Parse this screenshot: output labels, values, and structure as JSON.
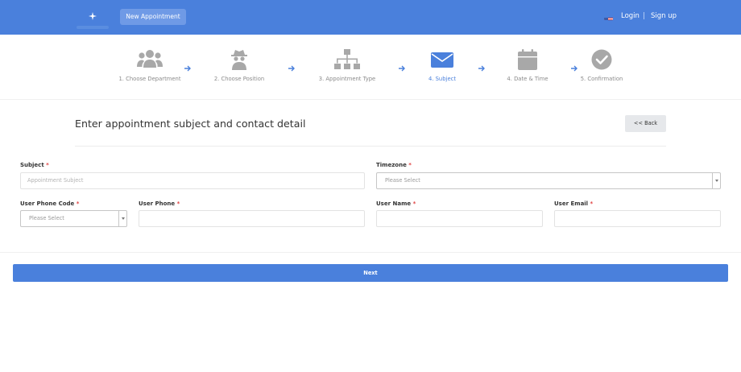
{
  "header": {
    "new_appointment_label": "New Appointment",
    "login_label": "Login",
    "separator": "|",
    "signup_label": "Sign up"
  },
  "steps": [
    {
      "label": "1. Choose Department",
      "icon": "users-icon",
      "active": false
    },
    {
      "label": "2. Choose Position",
      "icon": "spy-icon",
      "active": false
    },
    {
      "label": "3. Appointment Type",
      "icon": "sitemap-icon",
      "active": false
    },
    {
      "label": "4. Subject",
      "icon": "envelope-icon",
      "active": true
    },
    {
      "label": "4. Date & Time",
      "icon": "calendar-icon",
      "active": false
    },
    {
      "label": "5. Confirmation",
      "icon": "check-circle-icon",
      "active": false
    }
  ],
  "section": {
    "title": "Enter appointment subject and contact detail",
    "back_label": "<< Back"
  },
  "form": {
    "subject_label": "Subject",
    "subject_placeholder": "Appointment Subject",
    "timezone_label": "Timezone",
    "timezone_value": "Please Select",
    "phone_code_label": "User Phone Code",
    "phone_code_value": "Please Select",
    "phone_label": "User Phone",
    "name_label": "User Name",
    "email_label": "User Email",
    "required_mark": "*"
  },
  "next_label": "Next",
  "colors": {
    "primary": "#4a80dc",
    "step_inactive": "#9a9a9a",
    "required": "#e04343"
  }
}
